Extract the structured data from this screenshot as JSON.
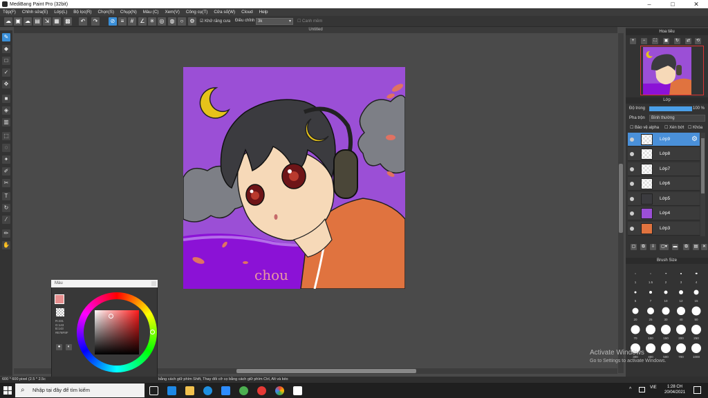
{
  "window": {
    "title": "MediBang Paint Pro (32bit)",
    "controls": [
      "–",
      "□",
      "✕"
    ]
  },
  "menu": [
    "Tệp(F)",
    "Chỉnh sửa(E)",
    "Lớp(L)",
    "Bộ lọc(R)",
    "Chọn(S)",
    "Chụp(N)",
    "Màu (C)",
    "Xem(V)",
    "Công cụ(T)",
    "Cửa số(W)",
    "Cloud",
    "Help"
  ],
  "toolbar": {
    "antialias_label": "Khử răng cưa",
    "adjust_label": "Điều chỉnh",
    "adjust_value": "3k",
    "edge_label": "Canh mềm"
  },
  "document": {
    "tab_title": "Untitled",
    "canvas_bg": "#9b4fd6",
    "floor_color": "#8b12d6",
    "signature": "chou"
  },
  "navigator": {
    "title": "Hoa tiêu"
  },
  "layers_panel": {
    "title": "Lớp",
    "opacity_label": "Độ trong",
    "opacity_value": "100 %",
    "blend_label": "Pha trộn",
    "blend_value": "Bình thường",
    "protect_alpha": "Bảo vệ alpha",
    "clipping": "Xén bớt",
    "lock": "Khóa",
    "layers": [
      {
        "name": "Lớp9",
        "selected": true
      },
      {
        "name": "Lớp8",
        "selected": false
      },
      {
        "name": "Lớp7",
        "selected": false
      },
      {
        "name": "Lớp6",
        "selected": false
      },
      {
        "name": "Lớp5",
        "selected": false
      },
      {
        "name": "Lớp4",
        "selected": false
      },
      {
        "name": "Lớp3",
        "selected": false
      }
    ]
  },
  "brush_size": {
    "title": "Brush Size",
    "labels": [
      "1",
      "1.5",
      "2",
      "3",
      "4",
      "5",
      "7",
      "10",
      "12",
      "15",
      "20",
      "25",
      "30",
      "40",
      "50",
      "70",
      "100",
      "150",
      "200",
      "250",
      "300",
      "400",
      "500",
      "700",
      "1000"
    ]
  },
  "color_panel": {
    "title": "Màu",
    "readout": [
      "R:231",
      "G:143",
      "B:143"
    ],
    "hex": "#E78F8F",
    "fg_color": "#e78f8f"
  },
  "status": {
    "size_text": "600 * 600 pixel  (2.5 * 2.5c",
    "hint_text": "bằng cách giữ phím Shift, Thay đổi cỡ cọ bằng cách giữ phím Ctrl, Alt và kéo"
  },
  "watermark": {
    "line1": "Activate Windows",
    "line2": "Go to Settings to activate Windows."
  },
  "taskbar": {
    "search_placeholder": "Nhập tại đây để tìm kiếm",
    "time": "1:28 CH",
    "date": "20/04/2021",
    "lang": "VIE"
  }
}
